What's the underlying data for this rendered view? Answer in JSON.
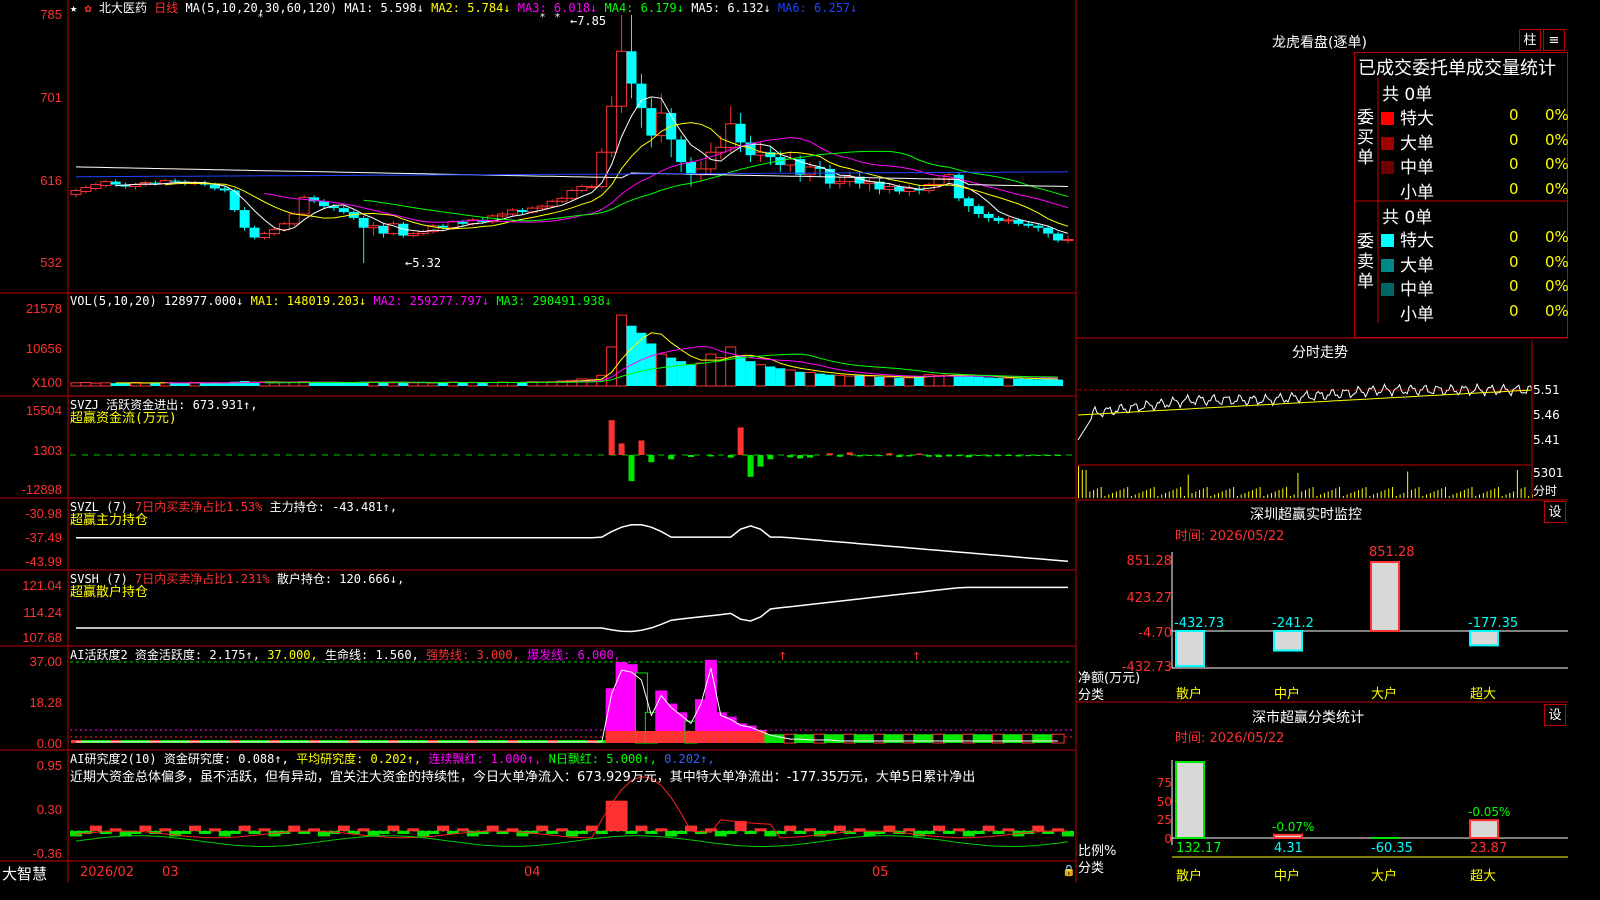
{
  "stock": {
    "title": "北大医药",
    "period": "日线"
  },
  "colors": {
    "up": "#ff3232",
    "down": "#00ffff",
    "green": "#00e600",
    "magenta": "#ff00ff",
    "yellow": "#ffff00",
    "blue": "#2040ff",
    "frame": "#c00000"
  },
  "kline": {
    "ma_label": "MA(5,10,20,30,60,120)",
    "ma_items": [
      {
        "text": "MA1: 5.598↓",
        "color": "#ffffff"
      },
      {
        "text": "MA2: 5.784↓",
        "color": "#ffff00"
      },
      {
        "text": "MA3: 6.018↓",
        "color": "#ff00ff"
      },
      {
        "text": "MA4: 6.179↓",
        "color": "#00ff00"
      },
      {
        "text": "MA5: 6.132↓",
        "color": "#ffffff"
      },
      {
        "text": "MA6: 6.257↓",
        "color": "#2040ff"
      }
    ],
    "axis": [
      "785",
      "701",
      "616",
      "532"
    ],
    "high_label": "7.85",
    "low_label": "5.32"
  },
  "vol": {
    "label": "VOL(5,10,20)",
    "value": "128977.000↓",
    "ma1": "MA1: 148019.203↓",
    "ma2": "MA2: 259277.797↓",
    "ma3": "MA3: 290491.938↓",
    "axis": [
      "21578",
      "10656",
      "X100"
    ]
  },
  "svzj": {
    "name": "SVZJ",
    "text": "活跃资金进出: 673.931↑,",
    "subtitle": "超赢资金流(万元)",
    "axis": [
      "15504",
      "1303",
      "-12898"
    ]
  },
  "svzl": {
    "name": "SVZL (7)",
    "text1": "7日内买卖净占比1.53%",
    "text2": "主力持仓: -43.481↑,",
    "subtitle": "超赢主力持仓",
    "axis": [
      "-30.98",
      "-37.49",
      "-43.99"
    ]
  },
  "svsh": {
    "name": "SVSH (7)",
    "text1": "7日内买卖净占比1.231%",
    "text2": "散户持仓: 120.666↓,",
    "subtitle": "超赢散户持仓",
    "axis": [
      "121.04",
      "114.24",
      "107.68"
    ]
  },
  "ai1": {
    "name": "AI活跃度2",
    "t1": "资金活跃度: 2.175↑,",
    "t2": "37.000,",
    "t3": "生命线: 1.560,",
    "t4": "强势线: 3.000,",
    "t5": "爆发线: 6.000,",
    "axis": [
      "37.00",
      "18.28",
      "0.00"
    ]
  },
  "ai2": {
    "name": "AI研究度2(10)",
    "t1": "资金研究度: 0.088↑,",
    "t2": "平均研究度: 0.202↑,",
    "t3": "连续飘红: 1.000↑,",
    "t4": "N日飘红: 5.000↑,",
    "t5": "0.202↑,",
    "comment": "近期大资金总体偏多，虽不活跃，但有异动，宜关注大资金的持续性，今日大单净流入：673.929万元，其中特大单净流出：-177.35万元，大单5日累计净出",
    "axis": [
      "0.95",
      "0.30",
      "-0.36"
    ]
  },
  "date_axis": {
    "brand": "大智慧",
    "labels": [
      "2026/02",
      "03",
      "04",
      "05"
    ]
  },
  "longhu": {
    "title": "龙虎看盘(逐单)",
    "btn1": "柱",
    "btn2": "≡",
    "header": "已成交委托单成交量统计",
    "buy": {
      "side": "委买单",
      "total": "共 0单",
      "rows": [
        {
          "label": "特大",
          "qty": "0",
          "pct": "0%",
          "color": "#ff0000"
        },
        {
          "label": "大单",
          "qty": "0",
          "pct": "0%",
          "color": "#a00000"
        },
        {
          "label": "中单",
          "qty": "0",
          "pct": "0%",
          "color": "#700000"
        },
        {
          "label": "小单",
          "qty": "0",
          "pct": "0%",
          "color": "#000000"
        }
      ]
    },
    "sell": {
      "side": "委卖单",
      "total": "共 0单",
      "rows": [
        {
          "label": "特大",
          "qty": "0",
          "pct": "0%",
          "color": "#00ffff"
        },
        {
          "label": "大单",
          "qty": "0",
          "pct": "0%",
          "color": "#008888"
        },
        {
          "label": "中单",
          "qty": "0",
          "pct": "0%",
          "color": "#006666"
        },
        {
          "label": "小单",
          "qty": "0",
          "pct": "0%",
          "color": "#000000"
        }
      ]
    }
  },
  "fenshi": {
    "title": "分时走势",
    "axis": [
      "5.51",
      "5.46",
      "5.41"
    ],
    "vol_label": "5301",
    "vol_unit": "分时"
  },
  "monitor": {
    "title": "深圳超赢实时监控",
    "btn": "设",
    "date": "时间: 2026/05/22",
    "axis": [
      "851.28",
      "423.27",
      "-4.70",
      "-432.73"
    ],
    "ylabel": "净额(万元)",
    "xlabel": "分类",
    "bars": [
      {
        "cat": "散户",
        "value": -432.73,
        "label": "-432.73"
      },
      {
        "cat": "中户",
        "value": -241.2,
        "label": "-241.2"
      },
      {
        "cat": "大户",
        "value": 851.28,
        "label": "851.28"
      },
      {
        "cat": "超大",
        "value": -177.35,
        "label": "-177.35"
      }
    ]
  },
  "classify": {
    "title": "深市超赢分类统计",
    "btn": "设",
    "date": "时间: 2026/05/22",
    "axis": [
      "75",
      "50",
      "25",
      "0"
    ],
    "ylabel": "比例%",
    "xlabel": "分类",
    "bars": [
      {
        "cat": "散户",
        "value": 132.17,
        "label": "132.17",
        "top": ""
      },
      {
        "cat": "中户",
        "value": 4.31,
        "label": "4.31",
        "top": "-0.07%"
      },
      {
        "cat": "大户",
        "value": -60.35,
        "label": "-60.35",
        "top": ""
      },
      {
        "cat": "超大",
        "value": 23.87,
        "label": "23.87",
        "top": "-0.05%"
      }
    ]
  },
  "series": {
    "k": [
      [
        6.02,
        6.06,
        5.99,
        6.08
      ],
      [
        6.05,
        6.09,
        6.03,
        6.11
      ],
      [
        6.08,
        6.12,
        6.06,
        6.14
      ],
      [
        6.11,
        6.15,
        6.09,
        6.17
      ],
      [
        6.15,
        6.12,
        6.1,
        6.17
      ],
      [
        6.12,
        6.1,
        6.08,
        6.14
      ],
      [
        6.1,
        6.12,
        6.07,
        6.14
      ],
      [
        6.12,
        6.14,
        6.1,
        6.16
      ],
      [
        6.14,
        6.13,
        6.11,
        6.16
      ],
      [
        6.13,
        6.16,
        6.11,
        6.18
      ],
      [
        6.16,
        6.15,
        6.13,
        6.18
      ],
      [
        6.15,
        6.13,
        6.11,
        6.17
      ],
      [
        6.13,
        6.14,
        6.11,
        6.16
      ],
      [
        6.14,
        6.12,
        6.1,
        6.16
      ],
      [
        6.12,
        6.08,
        6.06,
        6.14
      ],
      [
        6.08,
        6.06,
        6.04,
        6.1
      ],
      [
        6.06,
        5.86,
        5.84,
        6.08
      ],
      [
        5.86,
        5.68,
        5.65,
        5.89
      ],
      [
        5.68,
        5.58,
        5.56,
        5.7
      ],
      [
        5.58,
        5.62,
        5.56,
        5.64
      ],
      [
        5.62,
        5.66,
        5.6,
        5.68
      ],
      [
        5.66,
        5.72,
        5.64,
        5.74
      ],
      [
        5.72,
        5.82,
        5.7,
        5.84
      ],
      [
        5.82,
        5.99,
        5.8,
        6.01
      ],
      [
        5.99,
        5.95,
        5.93,
        6.01
      ],
      [
        5.95,
        5.9,
        5.88,
        5.97
      ],
      [
        5.9,
        5.88,
        5.85,
        5.92
      ],
      [
        5.88,
        5.84,
        5.82,
        5.9
      ],
      [
        5.84,
        5.78,
        5.76,
        5.86
      ],
      [
        5.78,
        5.68,
        5.32,
        5.8
      ],
      [
        5.68,
        5.7,
        5.6,
        5.74
      ],
      [
        5.7,
        5.62,
        5.58,
        5.72
      ],
      [
        5.62,
        5.72,
        5.6,
        5.75
      ],
      [
        5.72,
        5.6,
        5.58,
        5.74
      ],
      [
        5.6,
        5.62,
        5.58,
        5.64
      ],
      [
        5.62,
        5.64,
        5.6,
        5.66
      ],
      [
        5.64,
        5.7,
        5.62,
        5.72
      ],
      [
        5.7,
        5.68,
        5.66,
        5.72
      ],
      [
        5.68,
        5.74,
        5.66,
        5.76
      ],
      [
        5.74,
        5.72,
        5.7,
        5.76
      ],
      [
        5.72,
        5.76,
        5.7,
        5.78
      ],
      [
        5.76,
        5.74,
        5.72,
        5.78
      ],
      [
        5.74,
        5.8,
        5.72,
        5.82
      ],
      [
        5.8,
        5.82,
        5.78,
        5.84
      ],
      [
        5.82,
        5.86,
        5.8,
        5.88
      ],
      [
        5.86,
        5.84,
        5.82,
        5.88
      ],
      [
        5.84,
        5.88,
        5.82,
        5.9
      ],
      [
        5.88,
        5.9,
        5.86,
        5.92
      ],
      [
        5.9,
        5.95,
        5.88,
        5.97
      ],
      [
        5.95,
        5.98,
        5.93,
        6.0
      ],
      [
        5.98,
        6.06,
        5.96,
        6.08
      ],
      [
        6.06,
        6.1,
        6.04,
        6.12
      ],
      [
        6.1,
        6.1,
        6.08,
        6.12
      ],
      [
        6.1,
        6.45,
        6.08,
        6.49
      ],
      [
        6.45,
        6.92,
        6.4,
        7.02
      ],
      [
        6.92,
        7.48,
        6.85,
        7.85
      ],
      [
        7.48,
        7.15,
        7.0,
        7.85
      ],
      [
        7.15,
        6.9,
        6.7,
        7.25
      ],
      [
        6.9,
        6.62,
        6.5,
        7.0
      ],
      [
        6.62,
        6.85,
        6.55,
        7.05
      ],
      [
        6.85,
        6.58,
        6.4,
        6.9
      ],
      [
        6.58,
        6.35,
        6.25,
        6.62
      ],
      [
        6.35,
        6.22,
        6.1,
        6.4
      ],
      [
        6.22,
        6.28,
        6.15,
        6.36
      ],
      [
        6.28,
        6.45,
        6.22,
        6.55
      ],
      [
        6.45,
        6.5,
        6.38,
        6.62
      ],
      [
        6.5,
        6.74,
        6.45,
        6.92
      ],
      [
        6.74,
        6.55,
        6.45,
        6.85
      ],
      [
        6.55,
        6.42,
        6.35,
        6.62
      ],
      [
        6.42,
        6.45,
        6.35,
        6.55
      ],
      [
        6.45,
        6.4,
        6.32,
        6.5
      ],
      [
        6.4,
        6.32,
        6.25,
        6.46
      ],
      [
        6.32,
        6.38,
        6.25,
        6.45
      ],
      [
        6.38,
        6.22,
        6.15,
        6.42
      ],
      [
        6.22,
        6.3,
        6.15,
        6.35
      ],
      [
        6.3,
        6.28,
        6.2,
        6.36
      ],
      [
        6.28,
        6.13,
        6.08,
        6.32
      ],
      [
        6.13,
        6.15,
        6.08,
        6.2
      ],
      [
        6.15,
        6.2,
        6.1,
        6.25
      ],
      [
        6.2,
        6.13,
        6.08,
        6.24
      ],
      [
        6.13,
        6.15,
        6.05,
        6.18
      ],
      [
        6.15,
        6.07,
        6.02,
        6.18
      ],
      [
        6.07,
        6.1,
        6.03,
        6.14
      ],
      [
        6.1,
        6.05,
        6.02,
        6.12
      ],
      [
        6.05,
        6.08,
        6.0,
        6.12
      ],
      [
        6.08,
        6.06,
        6.02,
        6.12
      ],
      [
        6.06,
        6.12,
        6.03,
        6.14
      ],
      [
        6.12,
        6.18,
        6.08,
        6.2
      ],
      [
        6.18,
        6.22,
        6.14,
        6.24
      ],
      [
        6.22,
        5.98,
        5.95,
        6.24
      ],
      [
        5.98,
        5.9,
        5.84,
        6.0
      ],
      [
        5.9,
        5.82,
        5.78,
        5.92
      ],
      [
        5.82,
        5.78,
        5.74,
        5.84
      ],
      [
        5.78,
        5.75,
        5.72,
        5.8
      ],
      [
        5.75,
        5.76,
        5.72,
        5.79
      ],
      [
        5.76,
        5.72,
        5.7,
        5.78
      ],
      [
        5.72,
        5.7,
        5.68,
        5.74
      ],
      [
        5.7,
        5.68,
        5.64,
        5.72
      ],
      [
        5.68,
        5.62,
        5.58,
        5.7
      ],
      [
        5.62,
        5.55,
        5.53,
        5.64
      ],
      [
        5.55,
        5.56,
        5.52,
        5.6
      ]
    ],
    "vol": [
      9,
      10,
      8,
      9,
      8,
      9,
      10,
      8,
      9,
      9,
      8,
      9,
      10,
      8,
      9,
      8,
      12,
      14,
      11,
      10,
      9,
      10,
      11,
      12,
      10,
      9,
      10,
      9,
      10,
      12,
      11,
      10,
      9,
      10,
      9,
      10,
      9,
      10,
      11,
      9,
      10,
      9,
      10,
      11,
      10,
      11,
      12,
      11,
      12,
      14,
      16,
      20,
      18,
      30,
      110,
      200,
      170,
      150,
      120,
      90,
      80,
      70,
      60,
      65,
      90,
      80,
      110,
      85,
      70,
      60,
      55,
      50,
      45,
      40,
      38,
      35,
      32,
      30,
      28,
      30,
      28,
      26,
      25,
      24,
      23,
      28,
      32,
      30,
      34,
      30,
      28,
      26,
      24,
      23,
      22,
      21,
      20,
      19,
      20,
      18
    ],
    "svzj": [
      0,
      0,
      0,
      0,
      0,
      0,
      0,
      0,
      0,
      0,
      0,
      0,
      0,
      0,
      0,
      0,
      0,
      0,
      0,
      0,
      0,
      0,
      0,
      0,
      0,
      0,
      0,
      0,
      0,
      0,
      0,
      0,
      0,
      0,
      0,
      0,
      0,
      0,
      0,
      0,
      0,
      0,
      0,
      0,
      0,
      0,
      0,
      0,
      0,
      0,
      0,
      0,
      0,
      0,
      12000,
      4000,
      -9000,
      5000,
      -2500,
      0,
      -1500,
      0,
      -700,
      0,
      -500,
      0,
      -900,
      9500,
      -7500,
      -4000,
      -1500,
      0,
      -800,
      -1200,
      -900,
      0,
      600,
      -600,
      900,
      -500,
      -300,
      -400,
      600,
      -700,
      -500,
      500,
      -600,
      -700,
      -500,
      -400,
      -800,
      -300,
      -500,
      -400,
      -300,
      -500,
      -400,
      -300,
      -300,
      -200
    ]
  }
}
